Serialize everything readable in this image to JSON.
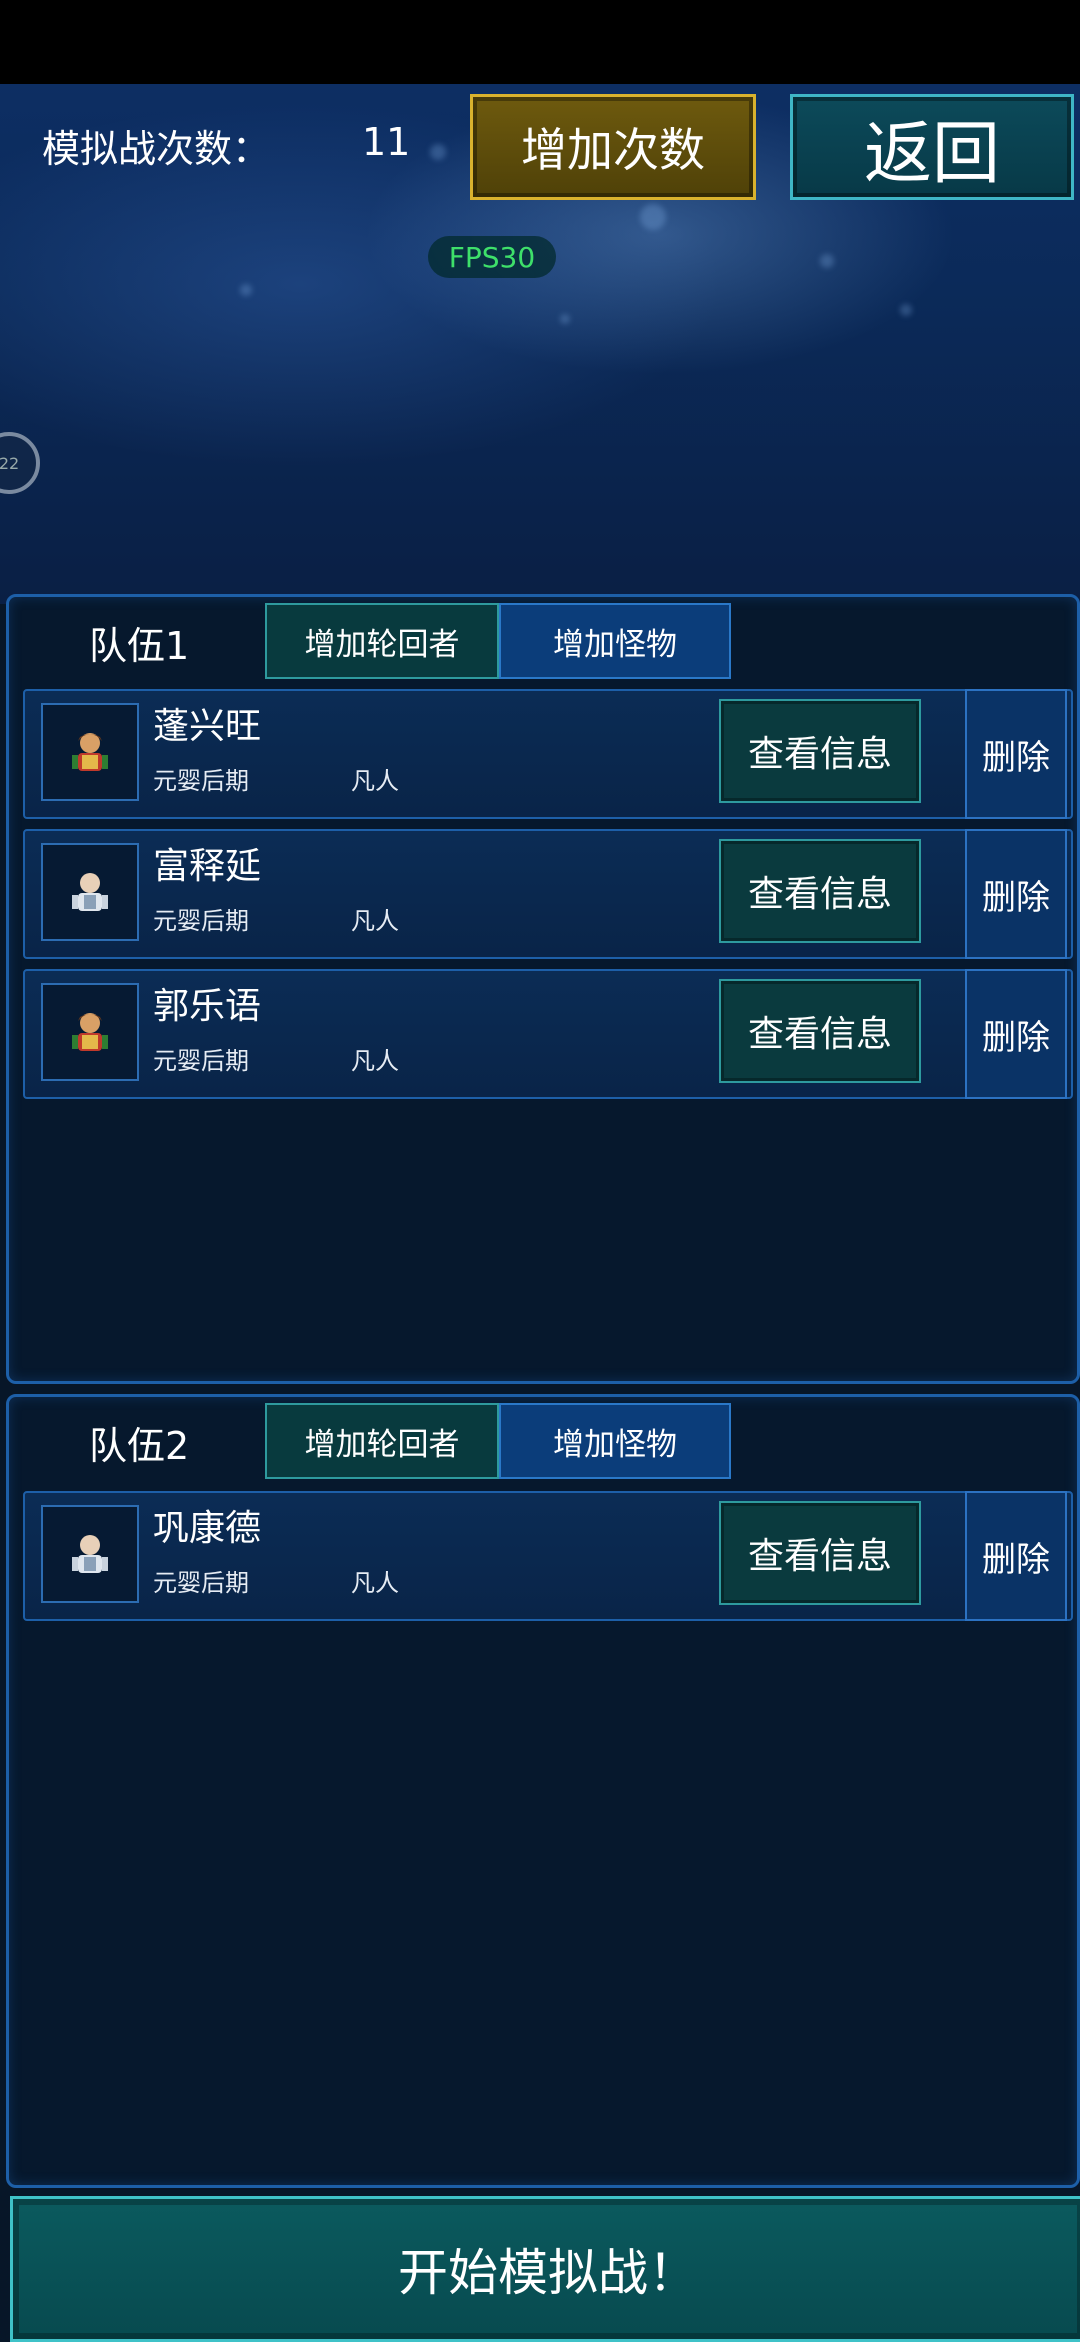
{
  "header": {
    "counter_label": "模拟战次数：",
    "counter_value": "11",
    "add_count_label": "增加次数",
    "back_label": "返回",
    "fps": "FPS30",
    "side_badge": "22"
  },
  "teams": [
    {
      "title": "队伍1",
      "add_reincarnator_label": "增加轮回者",
      "add_monster_label": "增加怪物",
      "members": [
        {
          "name": "蓬兴旺",
          "realm": "元婴后期",
          "class": "凡人",
          "view_label": "查看信息",
          "delete_label": "删除",
          "avatar_icon": "warrior-avatar-icon"
        },
        {
          "name": "富释延",
          "realm": "元婴后期",
          "class": "凡人",
          "view_label": "查看信息",
          "delete_label": "删除",
          "avatar_icon": "swordsman-avatar-icon"
        },
        {
          "name": "郭乐语",
          "realm": "元婴后期",
          "class": "凡人",
          "view_label": "查看信息",
          "delete_label": "删除",
          "avatar_icon": "warrior-avatar-icon"
        }
      ]
    },
    {
      "title": "队伍2",
      "add_reincarnator_label": "增加轮回者",
      "add_monster_label": "增加怪物",
      "members": [
        {
          "name": "巩康德",
          "realm": "元婴后期",
          "class": "凡人",
          "view_label": "查看信息",
          "delete_label": "删除",
          "avatar_icon": "swordsman-avatar-icon"
        }
      ]
    }
  ],
  "footer": {
    "start_label": "开始模拟战！"
  }
}
